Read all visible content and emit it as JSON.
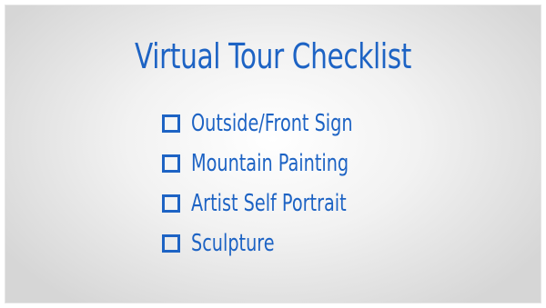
{
  "slide": {
    "title": "Virtual Tour Checklist",
    "accent_color": "#1d63c4",
    "items": [
      {
        "label": "Outside/Front Sign",
        "checked": false
      },
      {
        "label": "Mountain Painting",
        "checked": false
      },
      {
        "label": "Artist Self Portrait",
        "checked": false
      },
      {
        "label": "Sculpture",
        "checked": false
      }
    ]
  }
}
